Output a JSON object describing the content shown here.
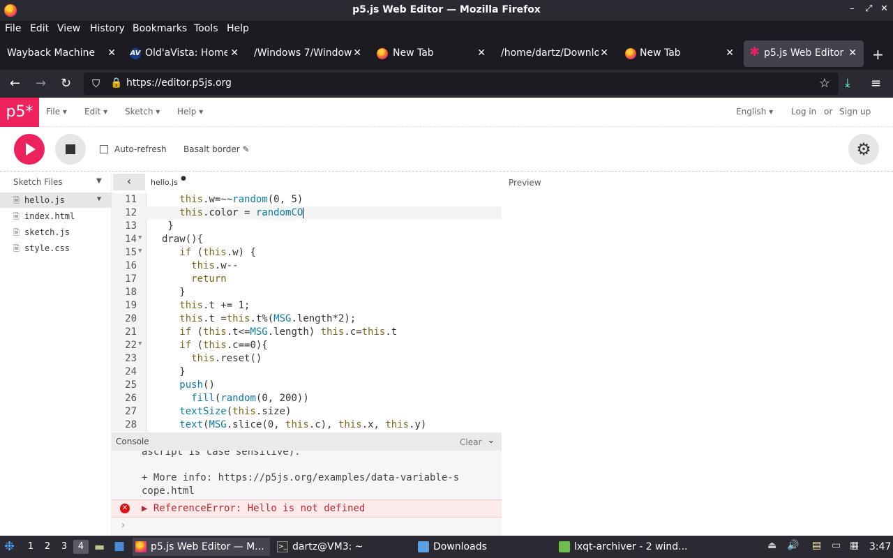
{
  "window": {
    "title": "p5.js Web Editor — Mozilla Firefox",
    "controls": [
      "–",
      "⤢",
      "✕"
    ]
  },
  "menu": [
    "File",
    "Edit",
    "View",
    "History",
    "Bookmarks",
    "Tools",
    "Help"
  ],
  "tabs": [
    {
      "label": "Wayback Machine",
      "icon": "none"
    },
    {
      "label": "Old'aVista: Home",
      "icon": "av"
    },
    {
      "label": "/Windows 7/Windows",
      "icon": "none"
    },
    {
      "label": "New Tab",
      "icon": "firefox"
    },
    {
      "label": "/home/dartz/Downloa",
      "icon": "none"
    },
    {
      "label": "New Tab",
      "icon": "firefox"
    },
    {
      "label": "p5.js Web Editor",
      "icon": "p5",
      "active": true
    }
  ],
  "address": {
    "url": "https://editor.p5js.org"
  },
  "p5": {
    "logo": "p5*",
    "menus": [
      "File",
      "Edit",
      "Sketch",
      "Help"
    ],
    "language": "English",
    "login": "Log in",
    "or": "or",
    "signup": "Sign up",
    "auto_refresh": "Auto-refresh",
    "sketch_name": "Basalt border",
    "sketch_files_header": "Sketch Files",
    "files": [
      "hello.js",
      "index.html",
      "sketch.js",
      "style.css"
    ],
    "open_file": "hello.js",
    "preview_label": "Preview",
    "accent": "#ed225d"
  },
  "code": [
    {
      "n": "11",
      "text": "    this.w=~~random(0, 5)"
    },
    {
      "n": "12",
      "text": "    this.color = randomCO",
      "current": true
    },
    {
      "n": "13",
      "text": "  }"
    },
    {
      "n": "14",
      "text": " draw(){",
      "fold": true
    },
    {
      "n": "15",
      "text": "    if (this.w) {",
      "fold": true
    },
    {
      "n": "16",
      "text": "      this.w--"
    },
    {
      "n": "17",
      "text": "      return"
    },
    {
      "n": "18",
      "text": "    }"
    },
    {
      "n": "19",
      "text": "    this.t += 1;"
    },
    {
      "n": "20",
      "text": "    this.t =this.t%(MSG.length*2);"
    },
    {
      "n": "21",
      "text": "    if (this.t<=MSG.length) this.c=this.t"
    },
    {
      "n": "22",
      "text": "    if (this.c==0){",
      "fold": true
    },
    {
      "n": "23",
      "text": "      this.reset()"
    },
    {
      "n": "24",
      "text": "    }"
    },
    {
      "n": "25",
      "text": "    push()"
    },
    {
      "n": "26",
      "text": "      fill(random(0, 200))"
    },
    {
      "n": "27",
      "text": "    textSize(this.size)"
    },
    {
      "n": "28",
      "text": "    text(MSG.slice(0, this.c), this.x, this.y)"
    }
  ],
  "console": {
    "title": "Console",
    "clear": "Clear",
    "lines": [
      "ascript is case sensitive).",
      "",
      "+ More info: https://p5js.org/examples/data-variable-s",
      "cope.html"
    ],
    "error": "▶ ReferenceError: Hello is not defined",
    "prompt": "›"
  },
  "taskbar": {
    "workspaces": [
      "1",
      "2",
      "3",
      "4"
    ],
    "active_workspace": "4",
    "items": [
      {
        "label": "p5.js Web Editor — M...",
        "active": true
      },
      {
        "label": "dartz@VM3: ~"
      },
      {
        "label": "Downloads"
      },
      {
        "label": "lxqt-archiver - 2 wind..."
      }
    ],
    "clock": "3:47"
  }
}
